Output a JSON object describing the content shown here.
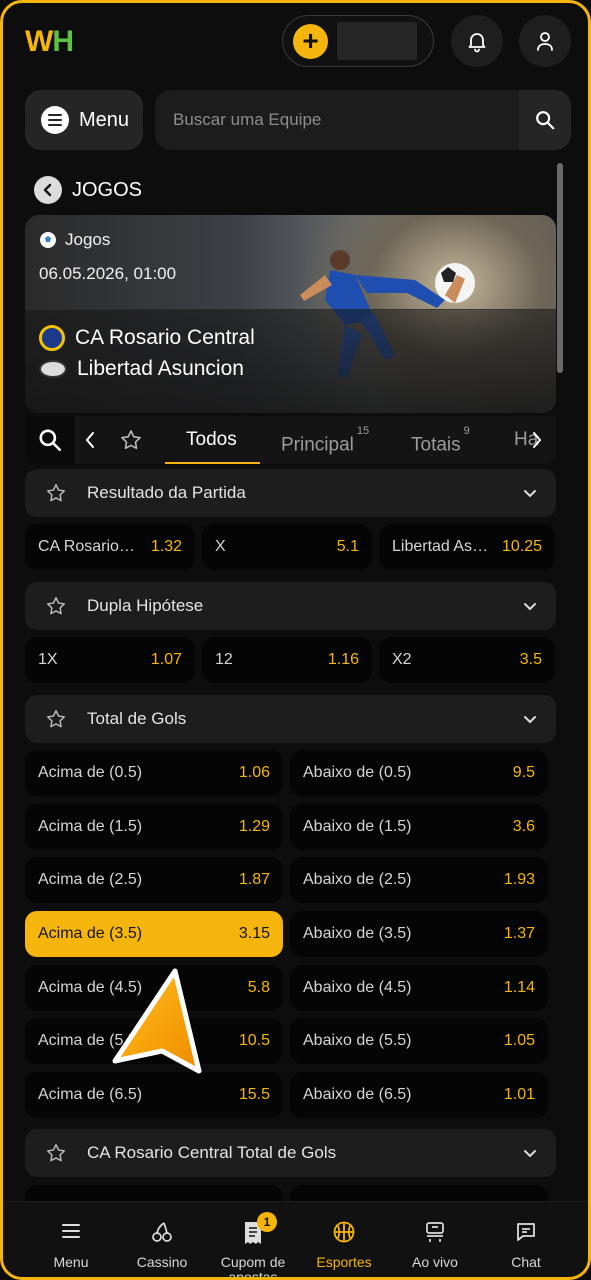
{
  "header": {
    "logo_w": "W",
    "logo_h": "H",
    "wallet_plus": "+"
  },
  "menu_label": "Menu",
  "search": {
    "placeholder": "Buscar uma Equipe"
  },
  "page_title": "JOGOS",
  "match": {
    "category": "Jogos",
    "datetime": "06.05.2026, 01:00",
    "home": "CA Rosario Central",
    "away": "Libertad Asuncion"
  },
  "tabs": [
    {
      "label": "Todos",
      "count": ""
    },
    {
      "label": "Principal",
      "count": "15"
    },
    {
      "label": "Totais",
      "count": "9"
    },
    {
      "label": "Ha",
      "count": ""
    }
  ],
  "markets": [
    {
      "title": "Resultado da Partida",
      "odds": [
        {
          "name": "CA Rosario Central",
          "value": "1.32"
        },
        {
          "name": "X",
          "value": "5.1"
        },
        {
          "name": "Libertad Asuncion",
          "value": "10.25"
        }
      ]
    },
    {
      "title": "Dupla Hipótese",
      "odds": [
        {
          "name": "1X",
          "value": "1.07"
        },
        {
          "name": "12",
          "value": "1.16"
        },
        {
          "name": "X2",
          "value": "3.5"
        }
      ]
    },
    {
      "title": "Total de Gols",
      "rows": [
        {
          "over": {
            "name": "Acima de (0.5)",
            "value": "1.06"
          },
          "under": {
            "name": "Abaixo de (0.5)",
            "value": "9.5"
          }
        },
        {
          "over": {
            "name": "Acima de (1.5)",
            "value": "1.29"
          },
          "under": {
            "name": "Abaixo de (1.5)",
            "value": "3.6"
          }
        },
        {
          "over": {
            "name": "Acima de (2.5)",
            "value": "1.87"
          },
          "under": {
            "name": "Abaixo de (2.5)",
            "value": "1.93"
          }
        },
        {
          "over": {
            "name": "Acima de (3.5)",
            "value": "3.15"
          },
          "under": {
            "name": "Abaixo de (3.5)",
            "value": "1.37"
          }
        },
        {
          "over": {
            "name": "Acima de (4.5)",
            "value": "5.8"
          },
          "under": {
            "name": "Abaixo de (4.5)",
            "value": "1.14"
          }
        },
        {
          "over": {
            "name": "Acima de (5.5)",
            "value": "10.5"
          },
          "under": {
            "name": "Abaixo de (5.5)",
            "value": "1.05"
          }
        },
        {
          "over": {
            "name": "Acima de (6.5)",
            "value": "15.5"
          },
          "under": {
            "name": "Abaixo de (6.5)",
            "value": "1.01"
          }
        }
      ]
    },
    {
      "title": "CA Rosario Central Total de Gols"
    }
  ],
  "bottom_nav": [
    {
      "label": "Menu"
    },
    {
      "label": "Cassino"
    },
    {
      "label": "Cupom de apostas",
      "badge": "1"
    },
    {
      "label": "Esportes"
    },
    {
      "label": "Ao vivo"
    },
    {
      "label": "Chat"
    }
  ],
  "colors": {
    "accent": "#f5b50c",
    "background": "#0d0d0d",
    "panel": "#1d1d1d"
  }
}
